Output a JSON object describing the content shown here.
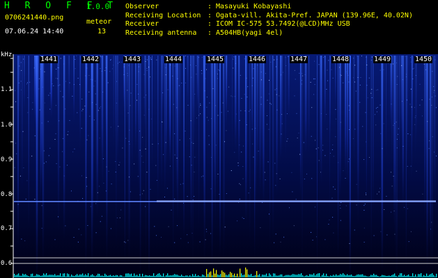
{
  "header": {
    "title": "H R O F F T",
    "version": "1.0.0",
    "filename": "0706241440.png",
    "datetime": "07.06.24 14:40",
    "meteor_label": "meteor",
    "meteor_count": "13"
  },
  "info": [
    {
      "key": "Observer",
      "value": "Masayuki Kobayashi"
    },
    {
      "key": "Receiving Location",
      "value": "Ogata-vill. Akita-Pref. JAPAN (139.96E, 40.02N)"
    },
    {
      "key": "Receiver",
      "value": "ICOM IC-575 53.7492(@LCD)MHz USB"
    },
    {
      "key": "Receiving antenna",
      "value": "A504HB(yagi 4el)"
    }
  ],
  "axis": {
    "unit": "kHz",
    "y_labels": [
      "1.1",
      "1.0",
      "0.9",
      "0.8",
      "0.7",
      "0.6"
    ],
    "x_labels": [
      "1441",
      "1442",
      "1443",
      "1444",
      "1445",
      "1446",
      "1447",
      "1448",
      "1449",
      "1450"
    ]
  },
  "colors": {
    "title": "#00ff00",
    "info_text": "#ffff00",
    "spectrum_bottom": "#00ffff",
    "spectrum_high": "#ffff00"
  }
}
